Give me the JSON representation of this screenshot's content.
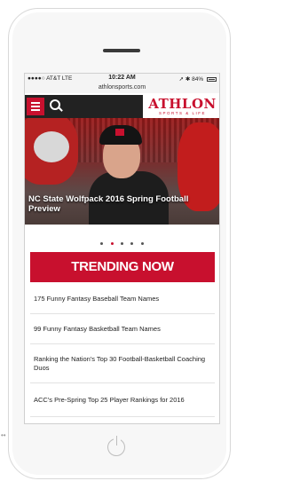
{
  "status_bar": {
    "carrier": "●●●●○ AT&T  LTE",
    "time": "10:22 AM",
    "battery": "84%"
  },
  "browser": {
    "url": "athlonsports.com"
  },
  "header": {
    "logo_main": "ATHLON",
    "logo_sub": "SPORTS & LIFE",
    "menu_icon": "hamburger-icon",
    "search_icon": "search-icon"
  },
  "hero": {
    "caption": "NC State Wolfpack 2016 Spring Football Preview",
    "carousel_dots": 5,
    "active_dot": 2
  },
  "trending": {
    "title": "TRENDING NOW",
    "items": [
      "175 Funny Fantasy Baseball Team Names",
      "99 Funny Fantasy Basketball Team Names",
      "Ranking the Nation's Top 30 Football-Basketball Coaching Duos",
      "ACC's Pre-Spring Top 25 Player Rankings for 2016"
    ]
  },
  "colors": {
    "brand_red": "#c8102e",
    "nav_dark": "#222222"
  }
}
